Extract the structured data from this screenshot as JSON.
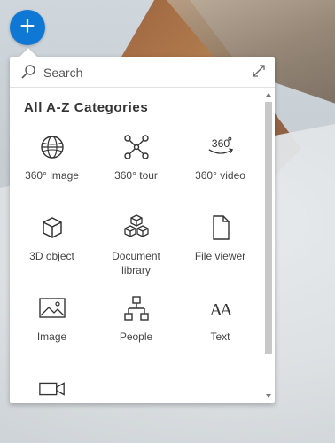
{
  "add_button": {
    "label": "+"
  },
  "search": {
    "placeholder": "Search"
  },
  "heading": "All A-Z Categories",
  "items": [
    {
      "label": "360° image",
      "icon": "globe-icon"
    },
    {
      "label": "360° tour",
      "icon": "tour-nodes-icon"
    },
    {
      "label": "360° video",
      "icon": "video-360-icon",
      "icon_text": "360"
    },
    {
      "label": "3D object",
      "icon": "cube-icon"
    },
    {
      "label": "Document library",
      "icon": "stacked-cubes-icon"
    },
    {
      "label": "File viewer",
      "icon": "file-icon"
    },
    {
      "label": "Image",
      "icon": "image-icon"
    },
    {
      "label": "People",
      "icon": "org-chart-icon"
    },
    {
      "label": "Text",
      "icon": "text-icon",
      "icon_text": "AA"
    },
    {
      "label": "",
      "icon": "video-camera-icon"
    }
  ]
}
